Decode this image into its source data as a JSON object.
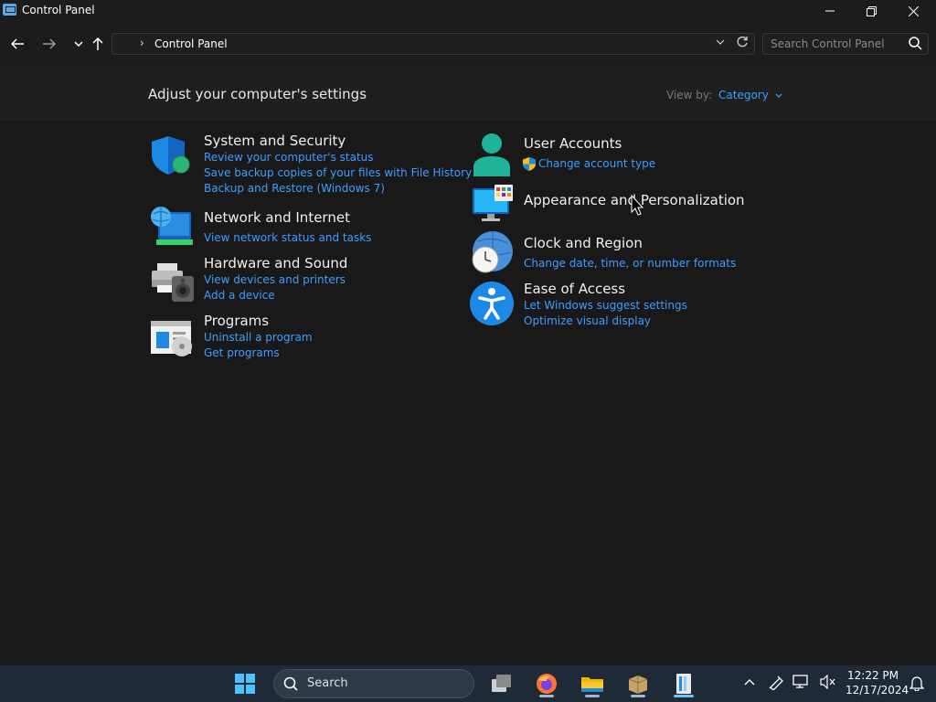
{
  "window": {
    "title": "Control Panel"
  },
  "address": {
    "crumb": "Control Panel"
  },
  "search": {
    "placeholder": "Search Control Panel"
  },
  "header": {
    "title": "Adjust your computer's settings",
    "view_by_label": "View by:",
    "view_by_value": "Category"
  },
  "categories": {
    "system_security": {
      "title": "System and Security",
      "links": [
        "Review your computer's status",
        "Save backup copies of your files with File History",
        "Backup and Restore (Windows 7)"
      ]
    },
    "network": {
      "title": "Network and Internet",
      "links": [
        "View network status and tasks"
      ]
    },
    "hardware": {
      "title": "Hardware and Sound",
      "links": [
        "View devices and printers",
        "Add a device"
      ]
    },
    "programs": {
      "title": "Programs",
      "links": [
        "Uninstall a program",
        "Get programs"
      ]
    },
    "user_accounts": {
      "title": "User Accounts",
      "links": [
        "Change account type"
      ]
    },
    "appearance": {
      "title": "Appearance and Personalization",
      "links": []
    },
    "clock": {
      "title": "Clock and Region",
      "links": [
        "Change date, time, or number formats"
      ]
    },
    "ease": {
      "title": "Ease of Access",
      "links": [
        "Let Windows suggest settings",
        "Optimize visual display"
      ]
    }
  },
  "taskbar": {
    "search_label": "Search",
    "time": "12:22 PM",
    "date": "12/17/2024"
  },
  "colors": {
    "link": "#3aa0ff",
    "background": "#191919",
    "taskbar": "#1e2a36"
  }
}
